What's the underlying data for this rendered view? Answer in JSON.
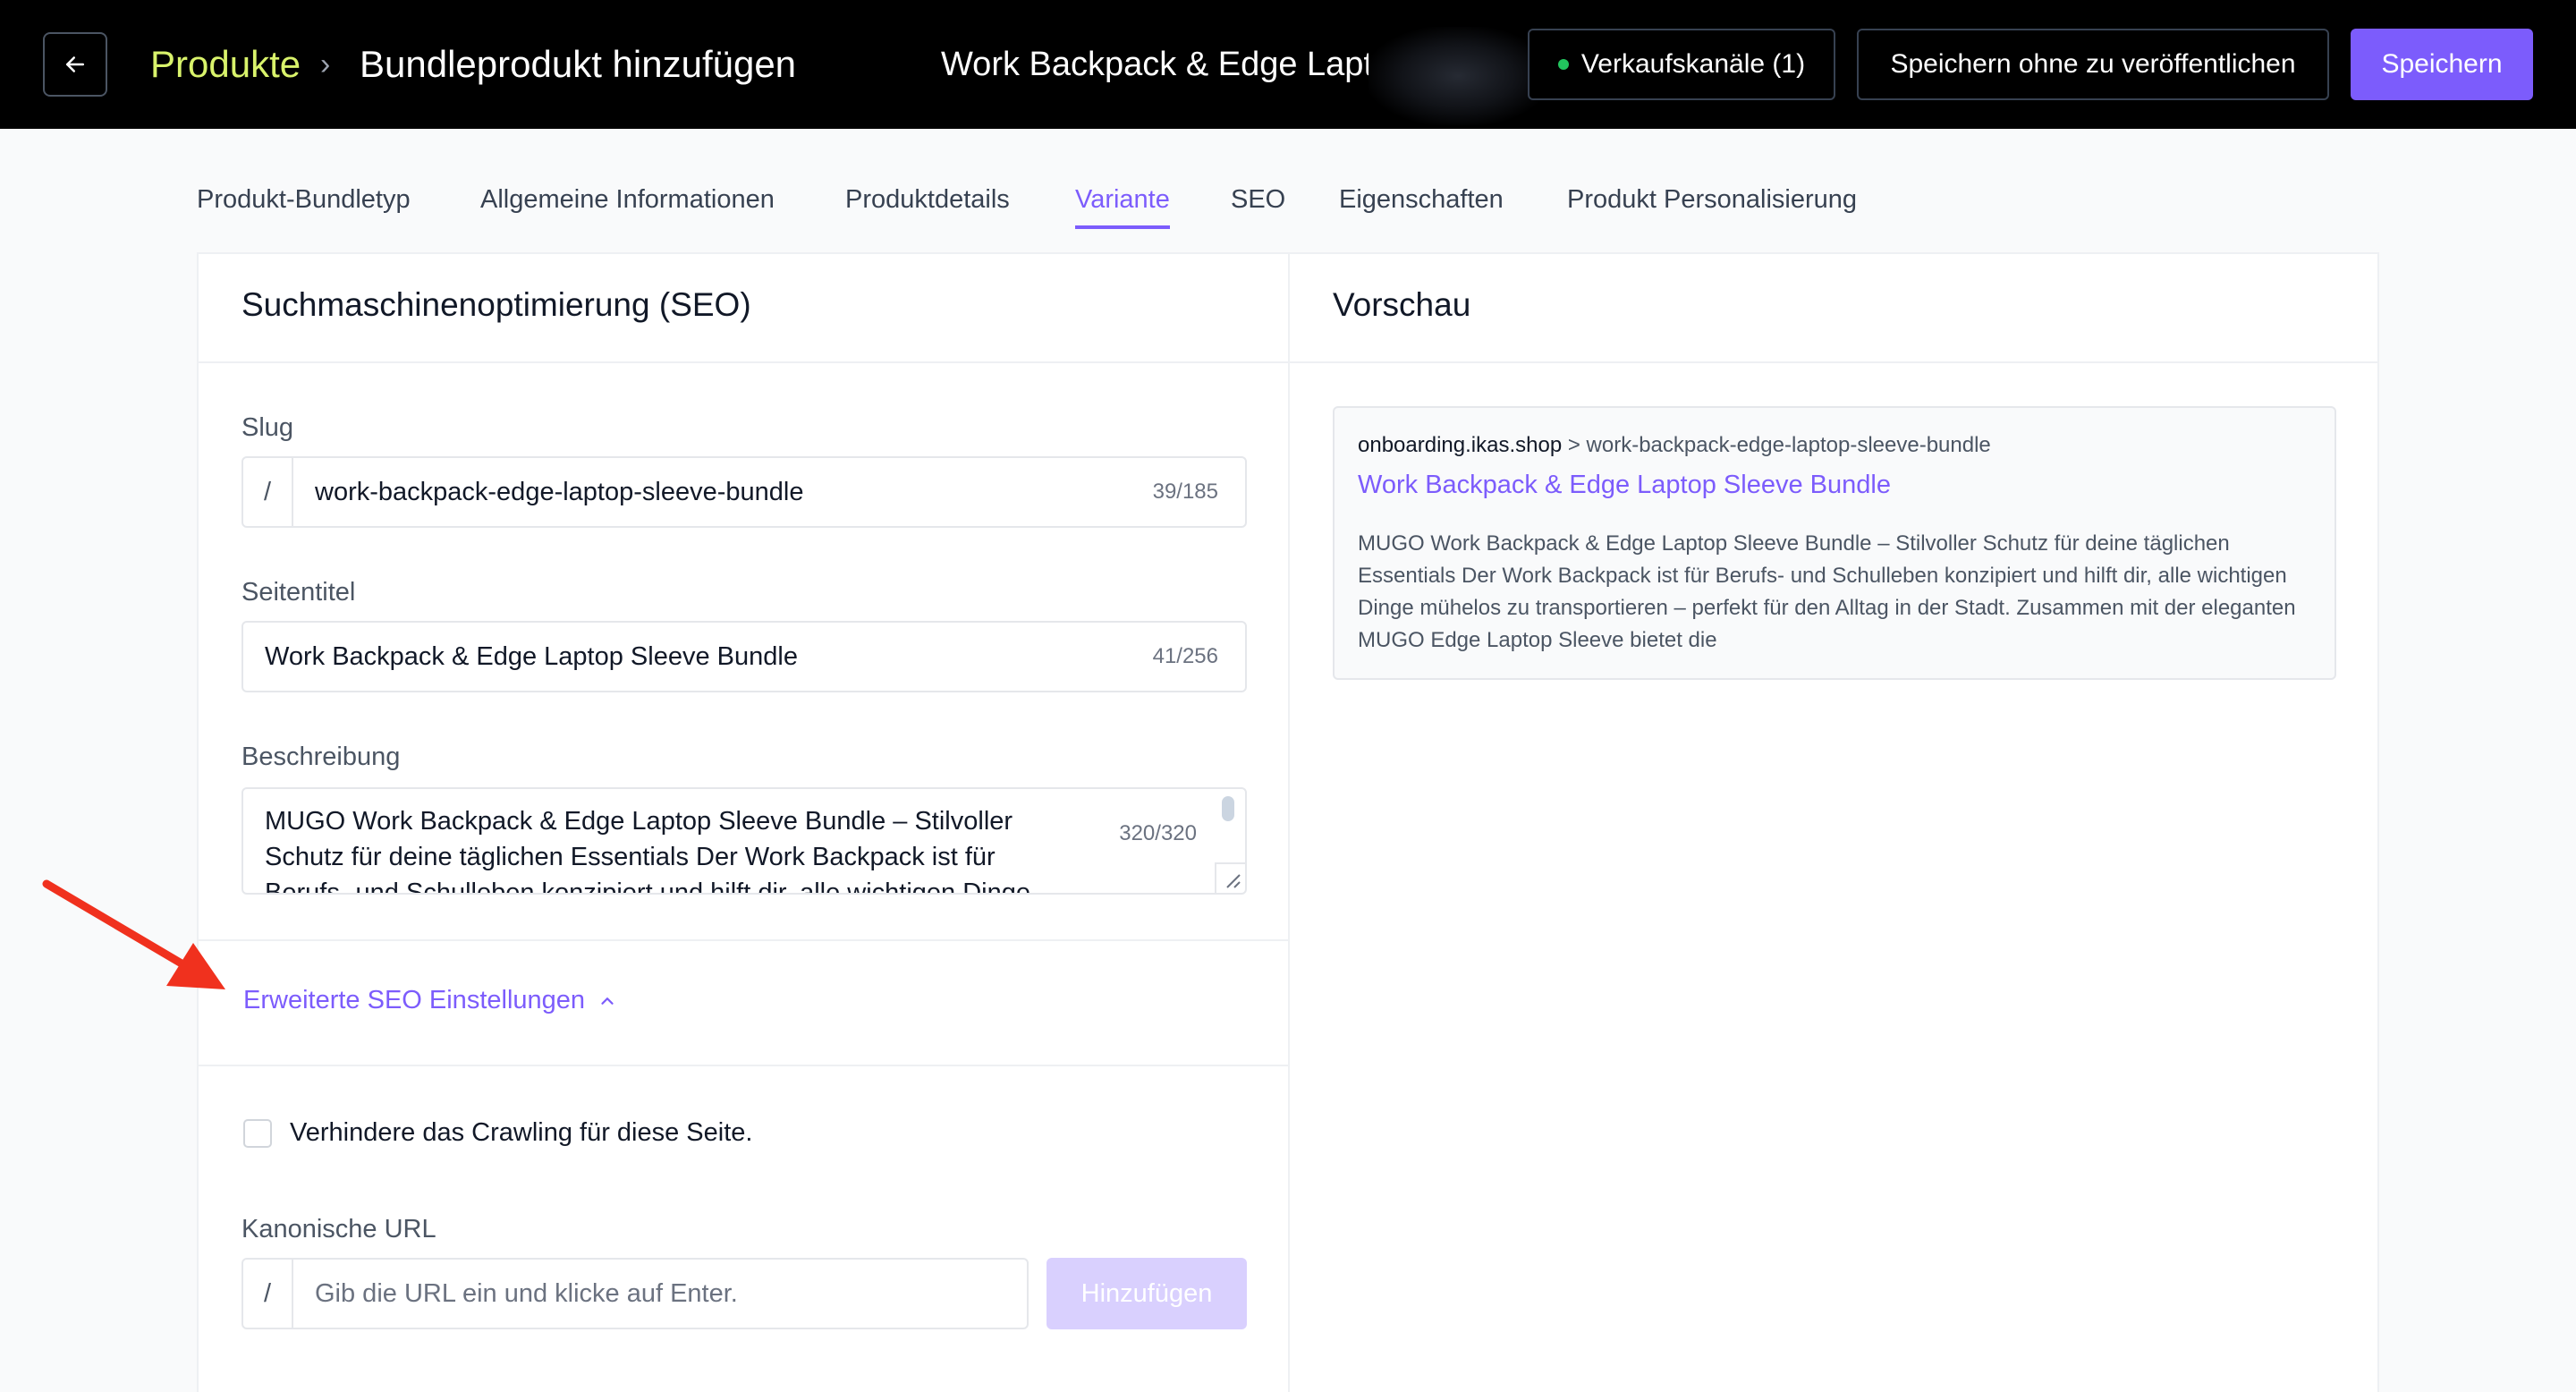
{
  "header": {
    "breadcrumb_root": "Produkte",
    "breadcrumb_separator": "›",
    "breadcrumb_current": "Bundleprodukt hinzufügen",
    "product_name": "Work Backpack & Edge Laptop Sleeve Bundle",
    "channels_label": "Verkaufskanäle (1)",
    "save_draft_label": "Speichern ohne zu veröffentlichen",
    "save_label": "Speichern"
  },
  "tabs": [
    {
      "label": "Produkt-Bundletyp"
    },
    {
      "label": "Allgemeine Informationen"
    },
    {
      "label": "Produktdetails"
    },
    {
      "label": "Variante"
    },
    {
      "label": "SEO"
    },
    {
      "label": "Eigenschaften"
    },
    {
      "label": "Produkt Personalisierung"
    }
  ],
  "active_tab": "Variante",
  "seo": {
    "title": "Suchmaschinenoptimierung (SEO)",
    "slug_label": "Slug",
    "slug_prefix": "/",
    "slug_value": "work-backpack-edge-laptop-sleeve-bundle",
    "slug_counter": "39/185",
    "page_title_label": "Seitentitel",
    "page_title_value": "Work Backpack & Edge Laptop Sleeve Bundle",
    "page_title_counter": "41/256",
    "description_label": "Beschreibung",
    "description_value": "MUGO Work Backpack & Edge Laptop Sleeve Bundle – Stilvoller Schutz für deine täglichen Essentials Der Work Backpack ist für Berufs- und Schulleben konzipiert und hilft dir, alle wichtigen Dinge",
    "description_counter": "320/320",
    "advanced_label": "Erweiterte SEO Einstellungen",
    "crawl_label": "Verhindere das Crawling für diese Seite.",
    "canonical_label": "Kanonische URL",
    "canonical_prefix": "/",
    "canonical_placeholder": "Gib die URL ein und klicke auf Enter.",
    "add_button": "Hinzufügen"
  },
  "preview": {
    "title": "Vorschau",
    "domain": "onboarding.ikas.shop",
    "path": " > work-backpack-edge-laptop-sleeve-bundle",
    "link_title": "Work Backpack & Edge Laptop Sleeve Bundle",
    "description": "MUGO Work Backpack & Edge Laptop Sleeve Bundle – Stilvoller Schutz für deine täglichen Essentials Der Work Backpack ist für Berufs- und Schulleben konzipiert und hilft dir, alle wichtigen Dinge mühelos zu transportieren – perfekt für den Alltag in der Stadt. Zusammen mit der eleganten MUGO Edge Laptop Sleeve bietet die"
  },
  "colors": {
    "accent": "#7c5cfc",
    "breadcrumb_root": "#d9f36b",
    "status_dot": "#22c55e",
    "annotation_arrow": "#f0311e"
  }
}
